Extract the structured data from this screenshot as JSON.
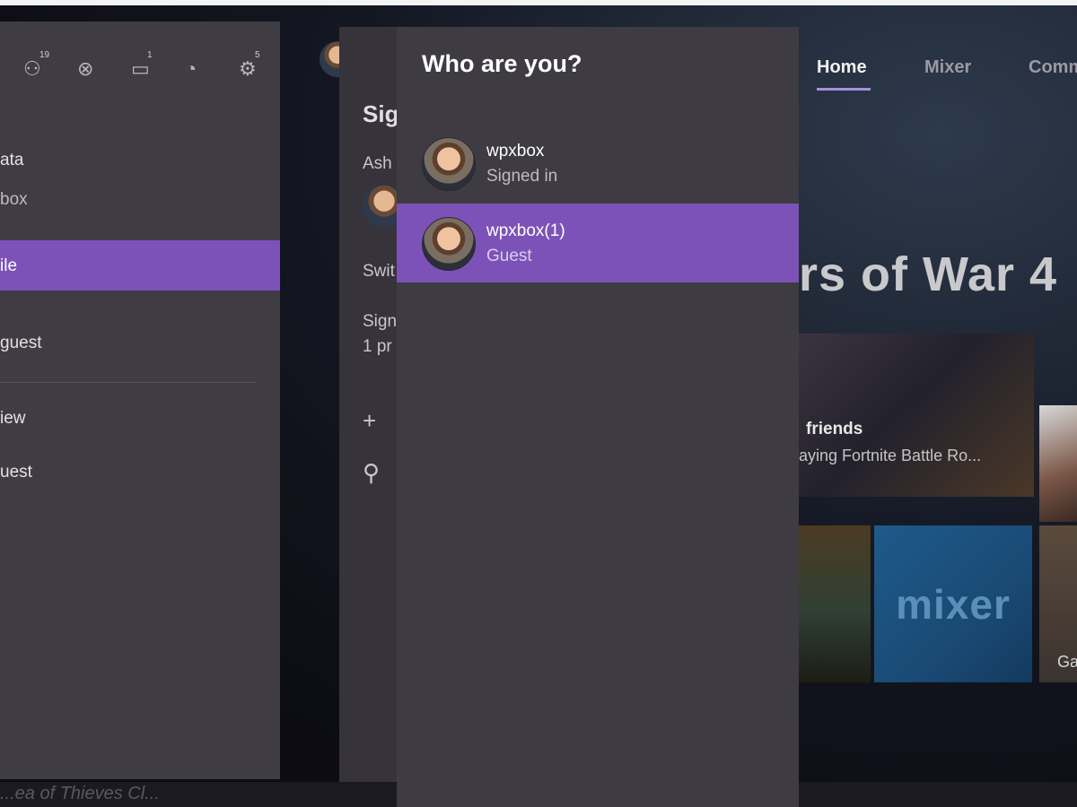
{
  "dashboard": {
    "nav": [
      "Home",
      "Mixer",
      "Comm"
    ],
    "hero_title": "rs of War 4",
    "friends_title": "friends",
    "friends_subtitle": "laying Fortnite Battle Ro...",
    "mixer_logo": "mixer",
    "tile_label": "Ga",
    "bottom_text": "...ea of Thieves    Cl..."
  },
  "guide": {
    "icons": [
      {
        "name": "friends-icon",
        "glyph": "⚇",
        "badge": "19"
      },
      {
        "name": "xbox-icon",
        "glyph": "⊗",
        "badge": ""
      },
      {
        "name": "messages-icon",
        "glyph": "▭",
        "badge": "1"
      },
      {
        "name": "broadcast-icon",
        "glyph": "◔",
        "badge": ""
      },
      {
        "name": "settings-icon",
        "glyph": "⚙",
        "badge": "5"
      }
    ],
    "items": [
      "ata",
      "box",
      "ile",
      "guest",
      "iew",
      "uest"
    ]
  },
  "profile": {
    "title": "Sig",
    "name": "Ash",
    "switch": "Swit",
    "sign": "Sign",
    "sign_sub": "1 pr",
    "add_icon": "+",
    "person_icon": "⚲"
  },
  "who": {
    "title": "Who are you?",
    "accounts": [
      {
        "name": "wpxbox",
        "status": "Signed in"
      },
      {
        "name": "wpxbox(1)",
        "status": "Guest"
      }
    ]
  }
}
